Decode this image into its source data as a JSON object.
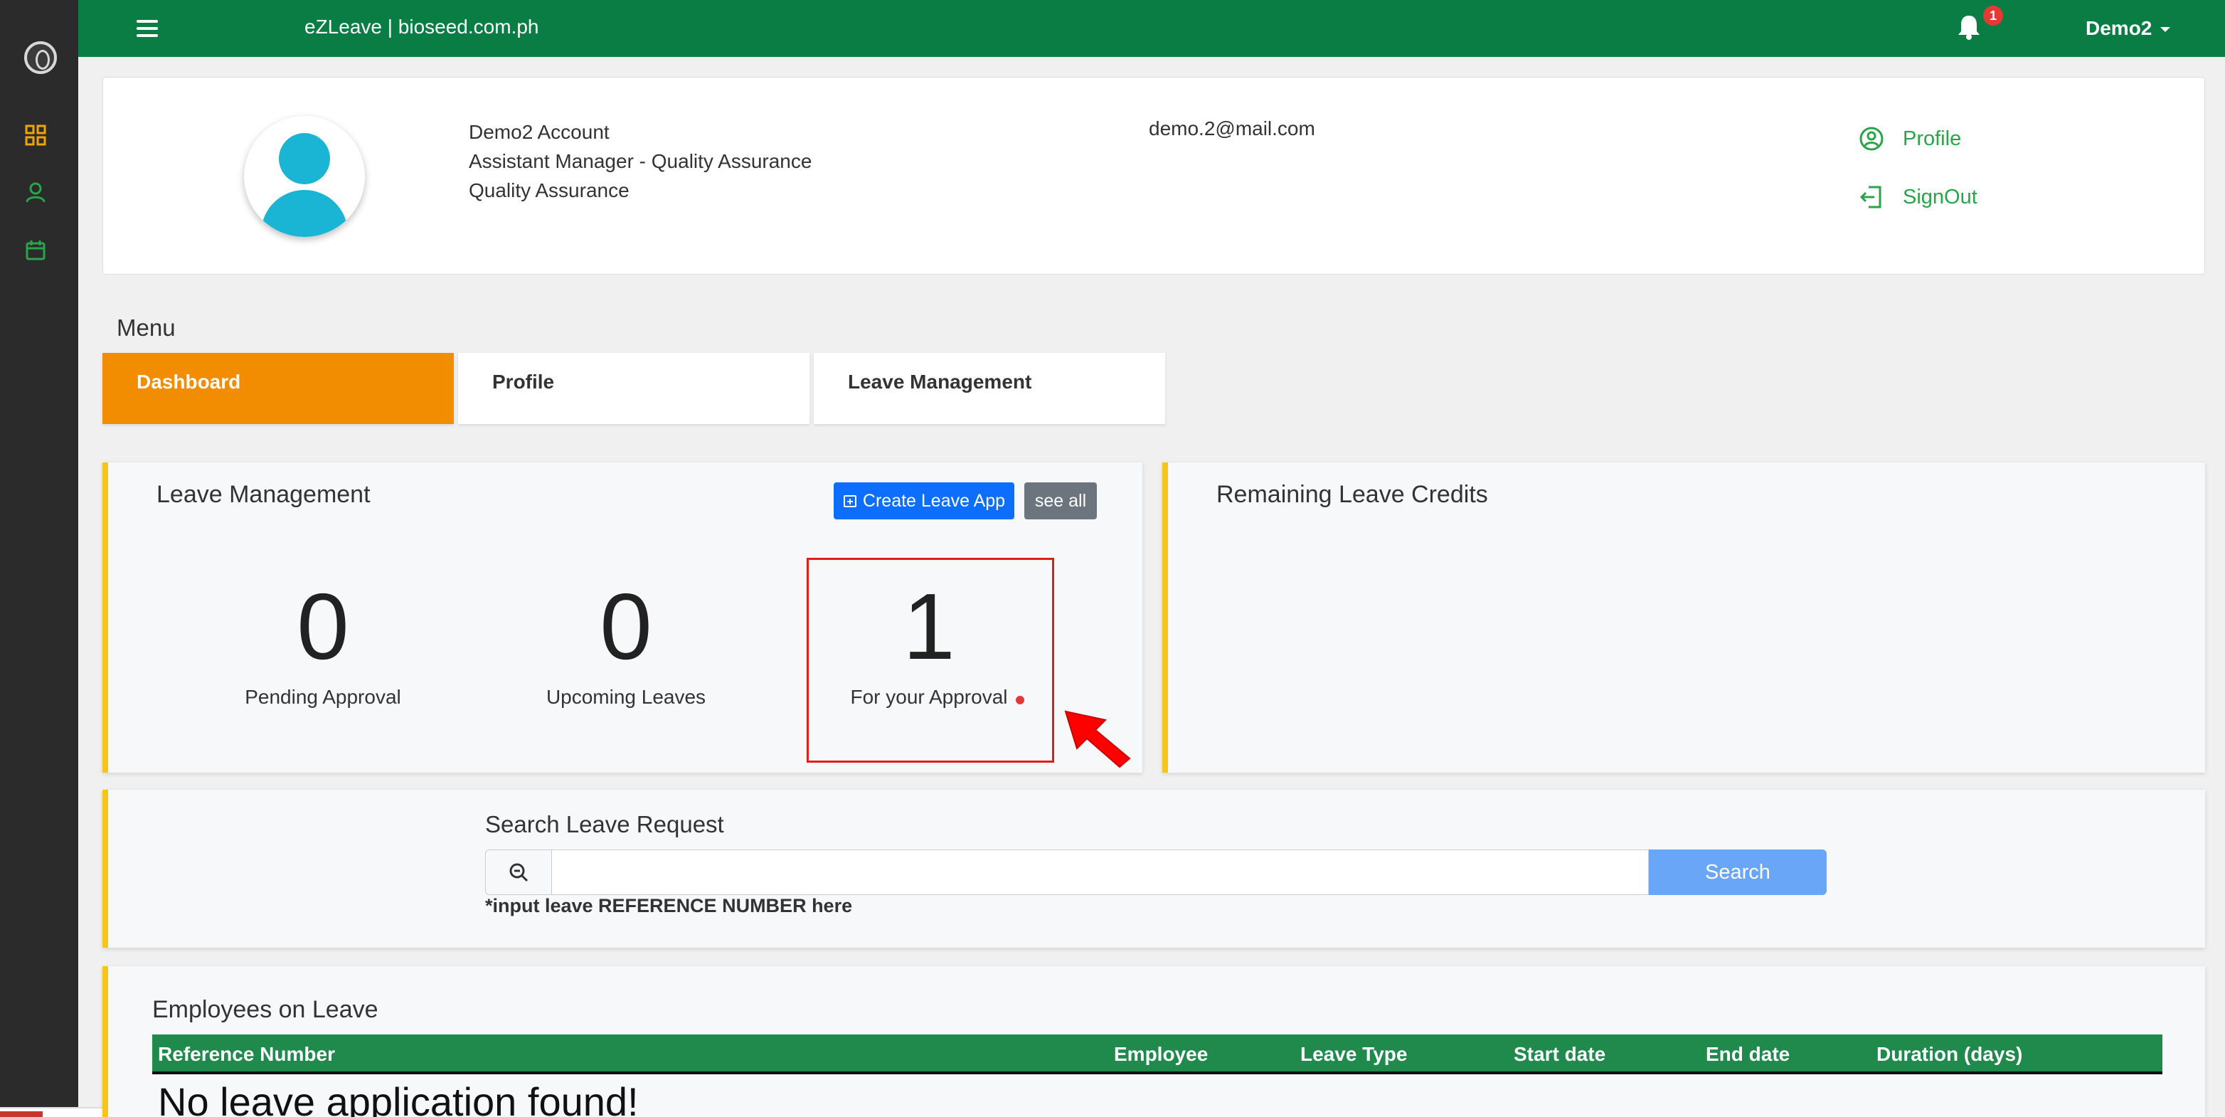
{
  "sidebar": {
    "items": [
      {
        "icon": "dashboard-grid-icon"
      },
      {
        "icon": "user-icon"
      },
      {
        "icon": "calendar-icon"
      }
    ]
  },
  "topbar": {
    "app_title": "eZLeave | bioseed.com.ph",
    "notification_count": "1",
    "user_name": "Demo2"
  },
  "profile": {
    "name": "Demo2 Account",
    "position": "Assistant Manager - Quality Assurance",
    "department": "Quality Assurance",
    "email": "demo.2@mail.com",
    "links": {
      "profile": "Profile",
      "signout": "SignOut"
    }
  },
  "menu": {
    "title": "Menu",
    "tabs": [
      {
        "label": "Dashboard",
        "active": true
      },
      {
        "label": "Profile",
        "active": false
      },
      {
        "label": "Leave Management",
        "active": false
      }
    ]
  },
  "leave_management": {
    "title": "Leave Management",
    "create_label": "Create Leave App",
    "see_all_label": "see all",
    "stats": [
      {
        "value": "0",
        "label": "Pending Approval"
      },
      {
        "value": "0",
        "label": "Upcoming Leaves"
      },
      {
        "value": "1",
        "label": "For your Approval"
      }
    ]
  },
  "remaining_credits": {
    "title": "Remaining Leave Credits"
  },
  "search": {
    "title": "Search Leave Request",
    "placeholder": "",
    "button_label": "Search",
    "hint": "*input leave REFERENCE NUMBER here"
  },
  "employees_on_leave": {
    "title": "Employees on Leave",
    "columns": [
      "Reference Number",
      "Employee",
      "Leave Type",
      "Start date",
      "End date",
      "Duration (days)"
    ],
    "empty_message": "No leave application found!"
  },
  "colors": {
    "topbar": "#0a7d45",
    "sidebar": "#2b2b2b",
    "active_tab": "#f28c00",
    "panel_accent": "#f5c518",
    "primary_button": "#0d6efd",
    "table_header": "#1f8a4c",
    "highlight": "#e01c1c"
  }
}
